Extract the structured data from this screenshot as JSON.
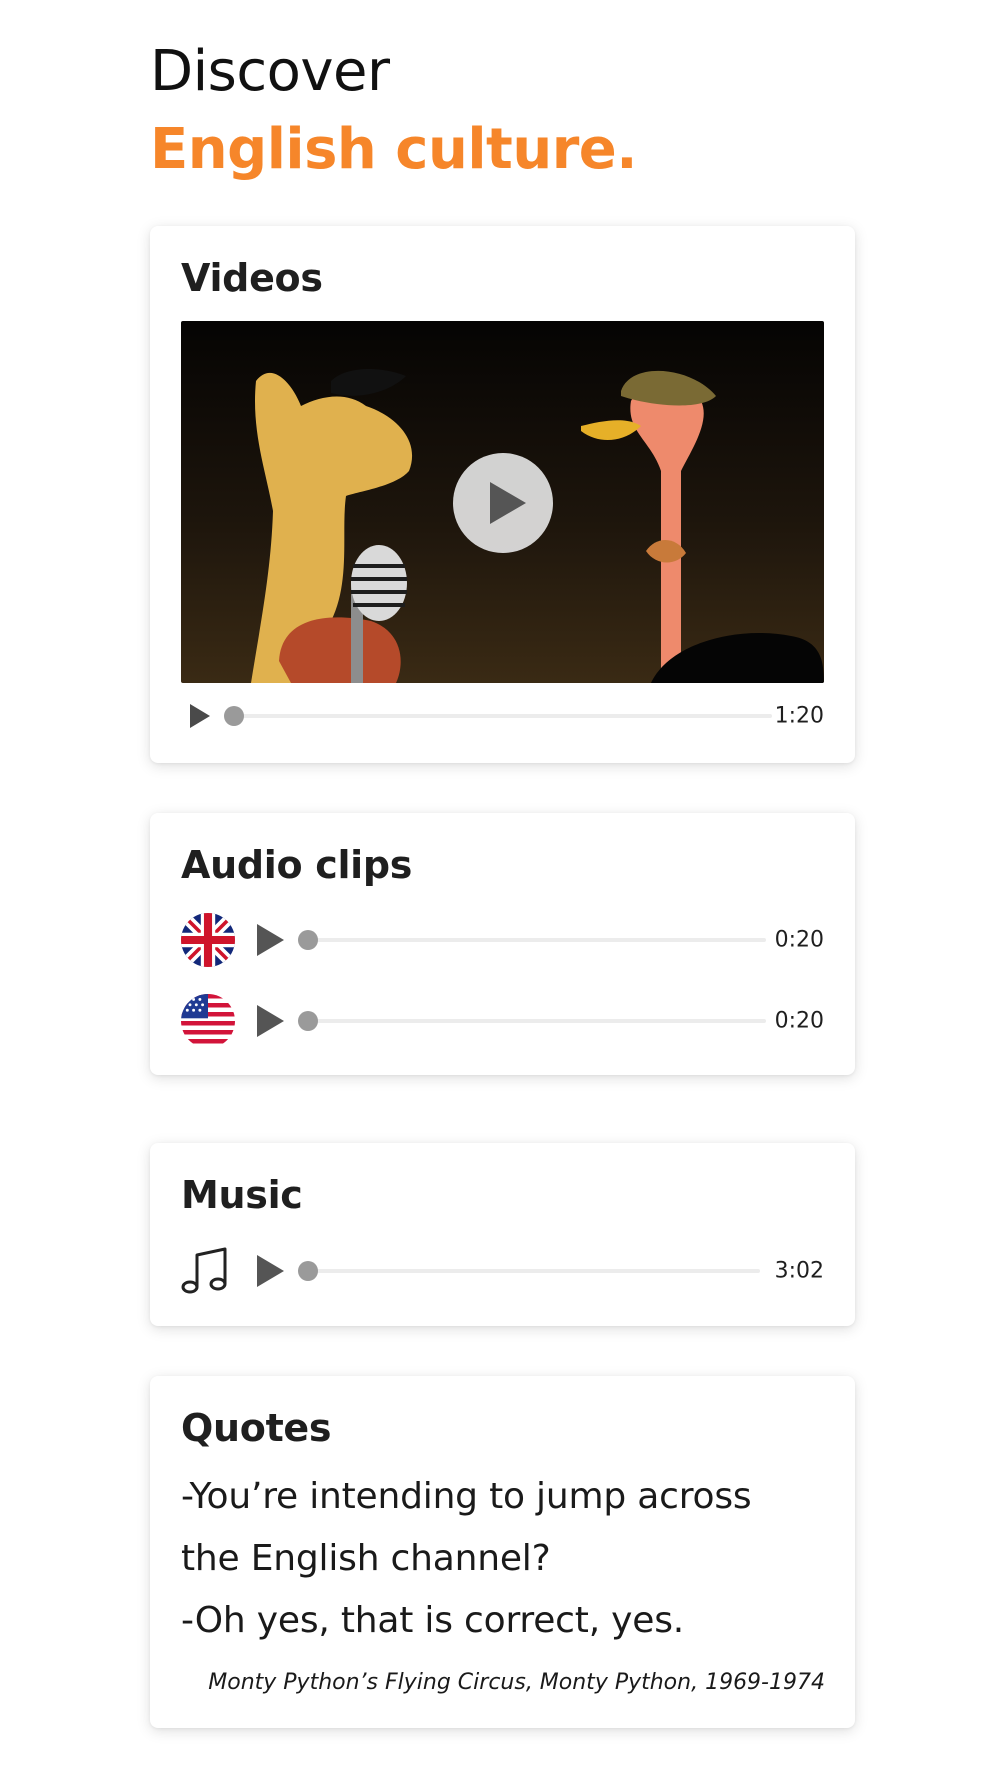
{
  "header": {
    "line1": "Discover",
    "line2": "English culture.",
    "accent_color": "#f6862a"
  },
  "videos": {
    "title": "Videos",
    "duration": "1:20",
    "progress": 0,
    "icon": "play-icon"
  },
  "audio": {
    "title": "Audio clips",
    "clips": [
      {
        "flag": "uk-flag-icon",
        "duration": "0:20",
        "progress": 0
      },
      {
        "flag": "us-flag-icon",
        "duration": "0:20",
        "progress": 0
      }
    ]
  },
  "music": {
    "title": "Music",
    "icon": "music-note-icon",
    "duration": "3:02",
    "progress": 0
  },
  "quotes": {
    "title": "Quotes",
    "lines": [
      "-You’re intending to jump across",
      "the English channel?",
      "-Oh yes, that is correct, yes."
    ],
    "source": "Monty Python’s Flying Circus, Monty Python, 1969-1974"
  }
}
